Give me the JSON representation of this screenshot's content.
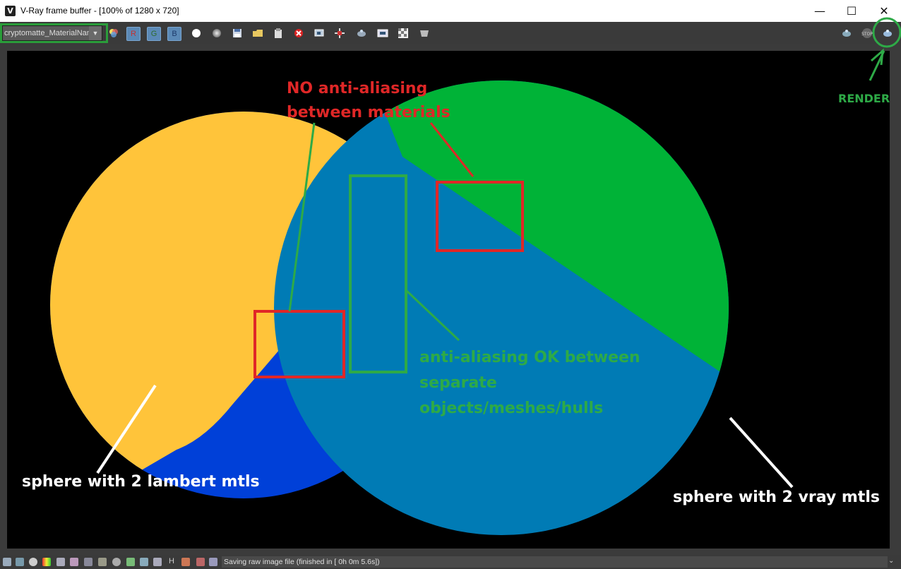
{
  "window": {
    "title": "V-Ray frame buffer - [100% of 1280 x 720]",
    "app_icon_letter": "V",
    "minimize_glyph": "—",
    "maximize_glyph": "☐",
    "close_glyph": "✕"
  },
  "toolbar": {
    "render_element_selected": "cryptomatte_MaterialName",
    "channels": {
      "r": "R",
      "g": "G",
      "b": "B"
    },
    "icons": [
      "color-corrections-icon",
      "red-channel-icon",
      "green-channel-icon",
      "blue-channel-icon",
      "alpha-icon",
      "mono-icon",
      "save-icon",
      "load-icon",
      "copy-icon",
      "clear-icon",
      "region-render-icon",
      "follow-mouse-icon",
      "render-last-icon",
      "vfb-history-icon",
      "test-resolution-icon",
      "track-mouse-icon",
      "interactive-render-icon",
      "stop-render-icon",
      "render-icon"
    ]
  },
  "annotations": {
    "no_aa": [
      "NO anti-aliasing",
      "between materials"
    ],
    "aa_ok": [
      "anti-aliasing OK between",
      "separate",
      "objects/meshes/hulls"
    ],
    "left_sphere": "sphere with 2 lambert mtls",
    "right_sphere": "sphere with 2 vray mtls",
    "render": "RENDER"
  },
  "statusbar": {
    "message": "Saving raw image file (finished in [ 0h  0m  5.6s])",
    "h_label": "H"
  },
  "colors": {
    "lambert_mtl_1": "#ffc43a",
    "lambert_mtl_2": "#0040d8",
    "vray_mtl_1": "#00b337",
    "vray_mtl_2": "#007bb5",
    "red_annotation": "#e02727",
    "green_annotation": "#2eaa47",
    "white_annotation": "#ffffff"
  }
}
